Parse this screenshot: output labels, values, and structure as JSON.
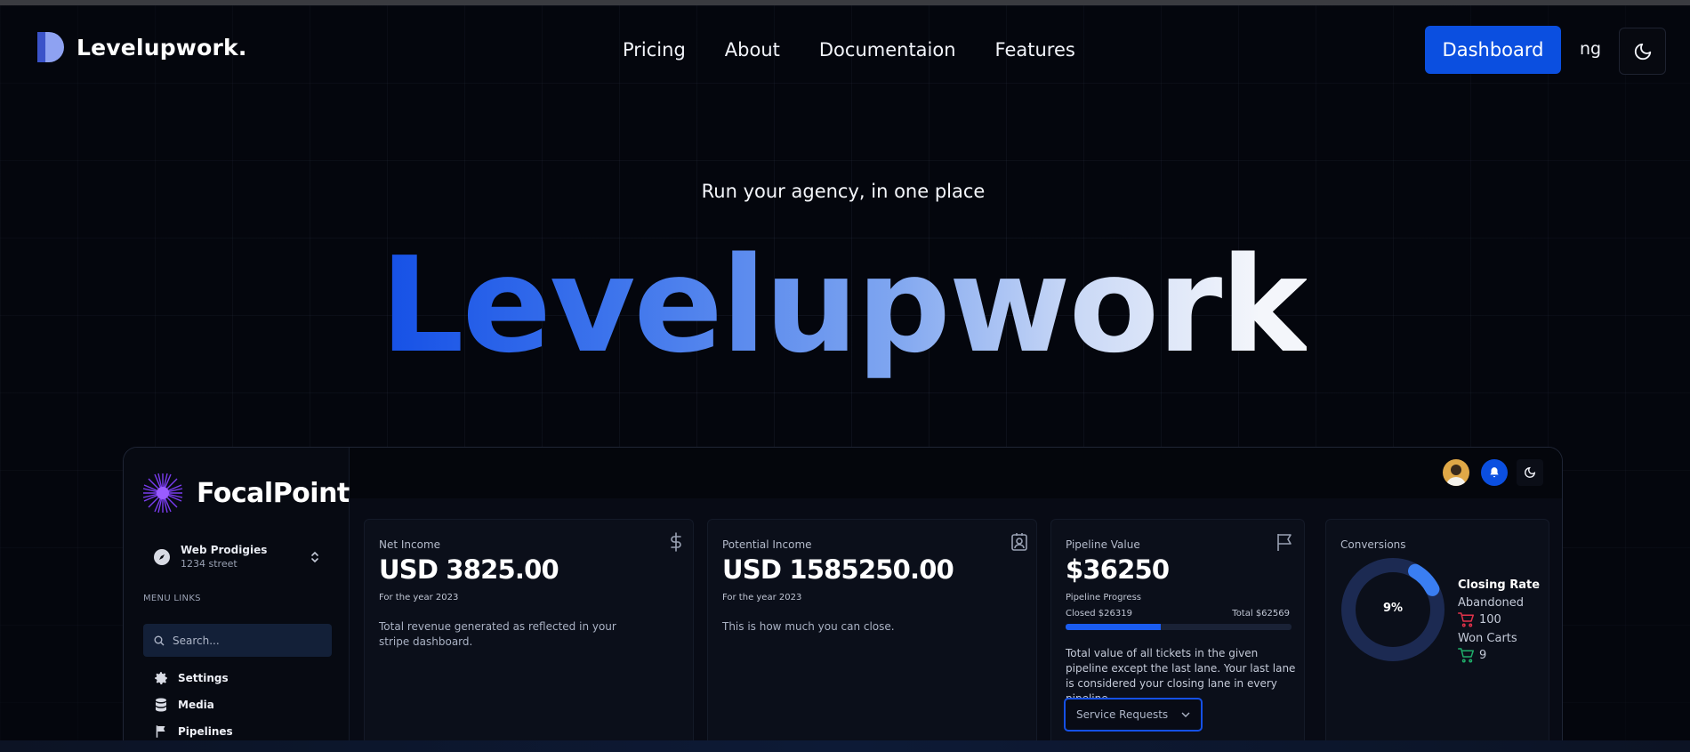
{
  "nav": {
    "brand": "Levelupwork.",
    "links": [
      "Pricing",
      "About",
      "Documentaion",
      "Features"
    ],
    "dashboard_label": "Dashboard",
    "lang": "ng",
    "theme_icon": "moon-icon"
  },
  "hero": {
    "tagline": "Run your agency, in one place",
    "title": "Levelupwork"
  },
  "preview": {
    "brand": "FocalPoint",
    "org_name": "Web Prodigies",
    "org_street": "1234 street",
    "menu_heading": "MENU LINKS",
    "search_placeholder": "Search...",
    "menu_items": [
      "Settings",
      "Media",
      "Pipelines"
    ],
    "cards": {
      "net_income": {
        "label": "Net Income",
        "value": "USD 3825.00",
        "sub": "For the year 2023",
        "desc": "Total revenue generated as reflected in your stripe dashboard."
      },
      "potential_income": {
        "label": "Potential Income",
        "value": "USD 1585250.00",
        "sub": "For the year 2023",
        "desc": "This is how much you can close."
      },
      "pipeline": {
        "label": "Pipeline Value",
        "value": "$36250",
        "progress_label": "Pipeline Progress",
        "closed": "Closed $26319",
        "total": "Total $62569",
        "progress_fraction": 0.42,
        "desc": "Total value of all tickets in the given pipeline except the last lane. Your last lane is considered your closing lane in every pipeline.",
        "select_value": "Service Requests"
      },
      "conversions": {
        "label": "Conversions",
        "percent_text": "9%",
        "percent": 9,
        "closing_title": "Closing Rate",
        "abandoned_label": "Abandoned",
        "abandoned_count": "100",
        "won_label": "Won Carts",
        "won_count": "9"
      }
    }
  },
  "colors": {
    "accent": "#0b4fe0",
    "background": "#04060d",
    "abandoned": "#e0324a",
    "won": "#1fae6a"
  }
}
